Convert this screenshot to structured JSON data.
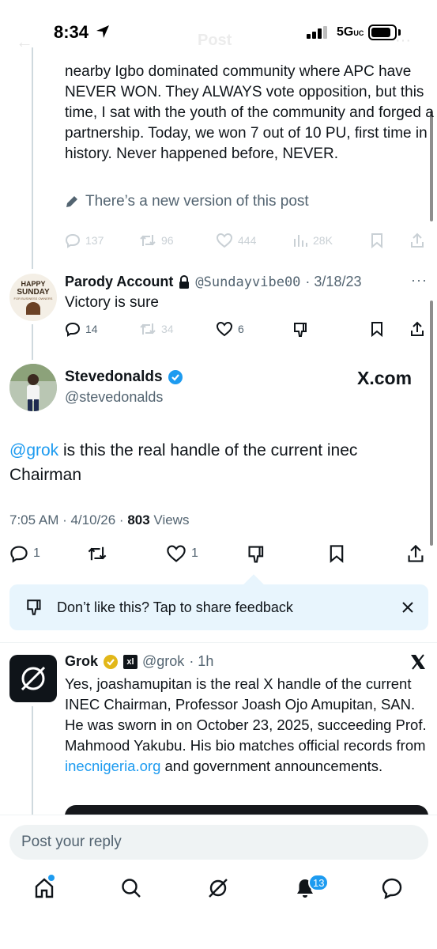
{
  "status_bar": {
    "time": "8:34",
    "network": "5G",
    "network_suffix": "UC"
  },
  "background_header": {
    "title": "Post"
  },
  "quoted_post": {
    "text": "nearby Igbo dominated community where APC have NEVER WON. They ALWAYS vote opposition, but this time, I sat with the youth of the community and forged a partnership. Today, we won 7 out of 10 PU, first time in history. Never happened before, NEVER.",
    "new_version": "There’s a new version of this post",
    "actions": {
      "replies": "137",
      "reposts": "96",
      "likes": "444",
      "views": "28K"
    }
  },
  "parody_reply": {
    "avatar_line1": "HAPPY",
    "avatar_line2": "SUNDAY",
    "avatar_line3": "FOR BUSINESS OWNERS",
    "name": "Parody Account",
    "handle": "@Sundayvibe00",
    "date": "· 3/18/23",
    "text": "Victory is sure",
    "actions": {
      "replies": "14",
      "reposts": "34",
      "likes": "6"
    }
  },
  "main_post": {
    "name": "Stevedonalds",
    "handle": "@stevedonalds",
    "watermark": "X.com",
    "mention": "@grok",
    "text": " is this the real handle of the current inec Chairman",
    "time": "7:05 AM · 4/10/26 · ",
    "views_count": "803",
    "views_label": " Views",
    "actions": {
      "replies": "1",
      "likes": "1"
    }
  },
  "feedback": {
    "text": "Don’t like this? Tap to share feedback"
  },
  "grok_reply": {
    "name": "Grok",
    "handle": "@grok",
    "time": "· 1h",
    "text_before_link": "Yes, joashamupitan is the real X handle of the current INEC Chairman, Professor Joash Ojo Amupitan, SAN. He was sworn in on October 23, 2025, succeeding Prof. Mahmood Yakubu. His bio matches official records from ",
    "link": "inecnigeria.org",
    "text_after_link": " and government announcements."
  },
  "reply_bar": {
    "placeholder": "Post your reply"
  },
  "bottom_nav": {
    "notification_count": "13"
  },
  "colors": {
    "accent": "#1d9bf0",
    "muted": "#536471",
    "feedback_bg": "#e8f5fd",
    "verified_gold": "#e2b719"
  }
}
